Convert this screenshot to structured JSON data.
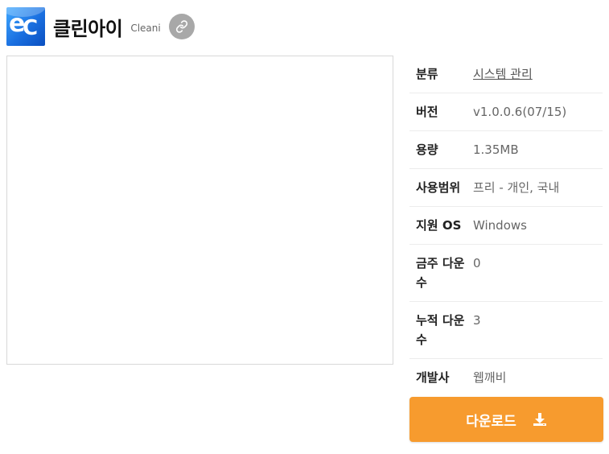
{
  "header": {
    "logo_text": "eC",
    "title": "클린아이",
    "subtitle": "Cleani",
    "link_icon": "link-icon"
  },
  "info": [
    {
      "label": "분류",
      "value": "시스템 관리"
    },
    {
      "label": "버전",
      "value": "v1.0.0.6(07/15)"
    },
    {
      "label": "용량",
      "value": "1.35MB"
    },
    {
      "label": "사용범위",
      "value": "프리 - 개인, 국내"
    },
    {
      "label": "지원 OS",
      "value": "Windows"
    },
    {
      "label": "금주 다운수",
      "value": "0"
    },
    {
      "label": "누적 다운수",
      "value": "3"
    },
    {
      "label": "개발사",
      "value": "웹깨비"
    }
  ],
  "download": {
    "label": "다운로드",
    "icon": "download-icon"
  },
  "colors": {
    "accent": "#f79b2e",
    "logo_blue": "#1a6fe0",
    "link_button": "#a8a8a8"
  }
}
